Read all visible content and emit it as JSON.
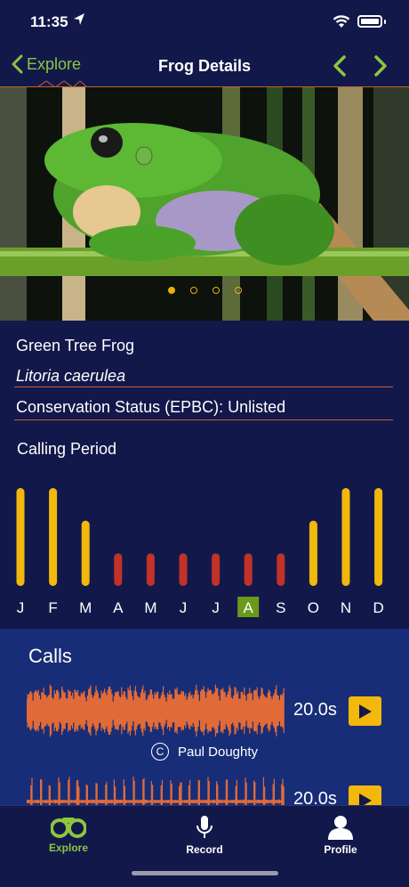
{
  "status_bar": {
    "time": "11:35"
  },
  "nav": {
    "back_label": "Explore",
    "title": "Frog Details"
  },
  "hero": {
    "pages": 4,
    "active_page": 0
  },
  "species": {
    "common_name": "Green Tree Frog",
    "scientific_name": "Litoria caerulea",
    "conservation_status": "Conservation Status (EPBC): Unlisted"
  },
  "calling_period_title": "Calling Period",
  "chart_data": {
    "type": "bar",
    "categories": [
      "J",
      "F",
      "M",
      "A",
      "M",
      "J",
      "J",
      "A",
      "S",
      "O",
      "N",
      "D"
    ],
    "values": [
      3,
      3,
      2,
      1,
      1,
      1,
      1,
      1,
      1,
      2,
      3,
      3
    ],
    "ylim": [
      0,
      3
    ],
    "highlight_index": 7,
    "colors": {
      "high": "#f2b80b",
      "low": "#c0322a",
      "highlight_bg": "#6a9a1a"
    }
  },
  "calls": {
    "title": "Calls",
    "items": [
      {
        "duration": "20.0s",
        "credit": "Paul Doughty"
      },
      {
        "duration": "20.0s"
      }
    ]
  },
  "tabs": [
    {
      "label": "Explore",
      "icon": "binoculars-icon",
      "active": true
    },
    {
      "label": "Record",
      "icon": "microphone-icon",
      "active": false
    },
    {
      "label": "Profile",
      "icon": "person-icon",
      "active": false
    }
  ],
  "colors": {
    "background": "#13184a",
    "calls_bg": "#182d77",
    "accent_green": "#8dc63f",
    "accent_orange": "#c0622d",
    "accent_yellow": "#f2b80b"
  }
}
